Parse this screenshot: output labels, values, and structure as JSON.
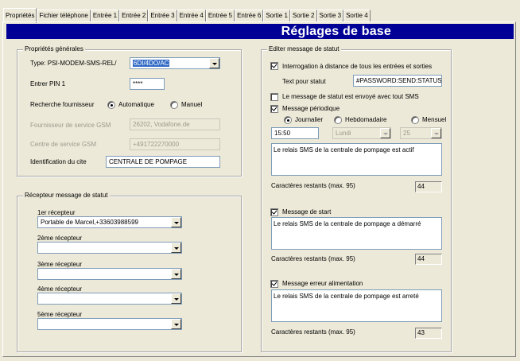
{
  "tabs": [
    "Propriétés",
    "Fichier téléphone",
    "Entrée 1",
    "Entrée 2",
    "Entrée 3",
    "Entrée 4",
    "Entrée 5",
    "Entrée 6",
    "Sortie 1",
    "Sortie 2",
    "Sortie 3",
    "Sortie 4"
  ],
  "title": "Réglages de base",
  "general": {
    "legend": "Propriétés générales",
    "type_label": "Type: PSI-MODEM-SMS-REL/",
    "type_value": "6DI/4DO/AC",
    "pin_label": "Entrer PIN 1",
    "pin_value": "****",
    "search_label": "Recherche fournisseur",
    "search_auto": "Automatique",
    "search_manual": "Manuel",
    "gsm_provider_label": "Fournisseur de service GSM",
    "gsm_provider_value": "26202, Vodafone.de",
    "gsm_center_label": "Centre de service GSM",
    "gsm_center_value": "+491722270000",
    "site_label": "Identification du cite",
    "site_value": "CENTRALE DE POMPAGE"
  },
  "receivers": {
    "legend": "Récepteur message de statut",
    "items": [
      {
        "label": "1er récepteur",
        "value": "Portable de Marcel,+33603988599"
      },
      {
        "label": "2ème récepteur",
        "value": ""
      },
      {
        "label": "3ème récepteur",
        "value": ""
      },
      {
        "label": "4ème récepteur",
        "value": ""
      },
      {
        "label": "5ème récepteur",
        "value": ""
      }
    ]
  },
  "status": {
    "legend": "Editer message de statut",
    "remote_query": "Interrogation à distance de tous les entrées et sorties",
    "text_label": "Text pour statut",
    "text_value": "#PASSWORD:SEND:STATUS",
    "send_all": "Le message de statut est envoyé avec tout SMS",
    "periodic": "Message périodique",
    "daily": "Journalier",
    "weekly": "Hebdomadaire",
    "monthly": "Mensuel",
    "time": "15:50",
    "weekday": "Lundi",
    "day": "25",
    "periodic_text": "Le relais SMS de la centrale de pompage est actif",
    "remaining_label": "Caractères restants (max. 95)",
    "periodic_count": "44",
    "start": "Message de start",
    "start_text": "Le relais SMS de la centrale de pompage a démarré",
    "start_count": "44",
    "power": "Message erreur alimentation",
    "power_text": "Le relais SMS de la centrale de pompage est arreté",
    "power_count": "43"
  }
}
